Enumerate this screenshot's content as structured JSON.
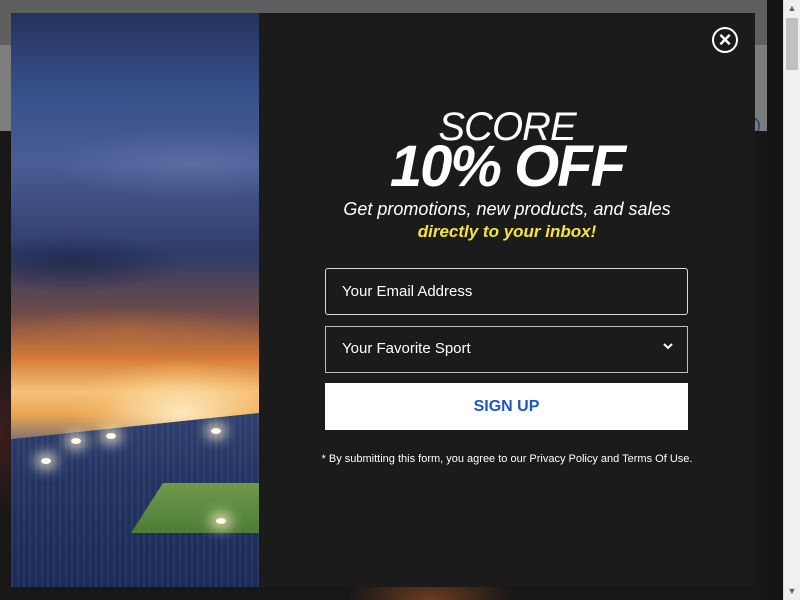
{
  "modal": {
    "close_label": "×",
    "kicker": "SCORE",
    "headline": "10% OFF",
    "subhead": "Get promotions, new products, and sales",
    "subhead_accent": "directly to your inbox!",
    "email_placeholder": "Your Email Address",
    "sport_select_value": "Your Favorite Sport",
    "signup_label": "SIGN UP",
    "disclaimer": "* By submitting this form, you agree to our Privacy Policy and Terms Of Use."
  },
  "scrollbar": {
    "up_arrow": "▲",
    "down_arrow": "▼"
  },
  "colors": {
    "modal_bg": "#1b1b1b",
    "accent_yellow": "#f6e33c",
    "button_text_blue": "#1c56c4",
    "white": "#ffffff"
  },
  "icons": [
    "close-icon",
    "chevron-down-icon"
  ]
}
